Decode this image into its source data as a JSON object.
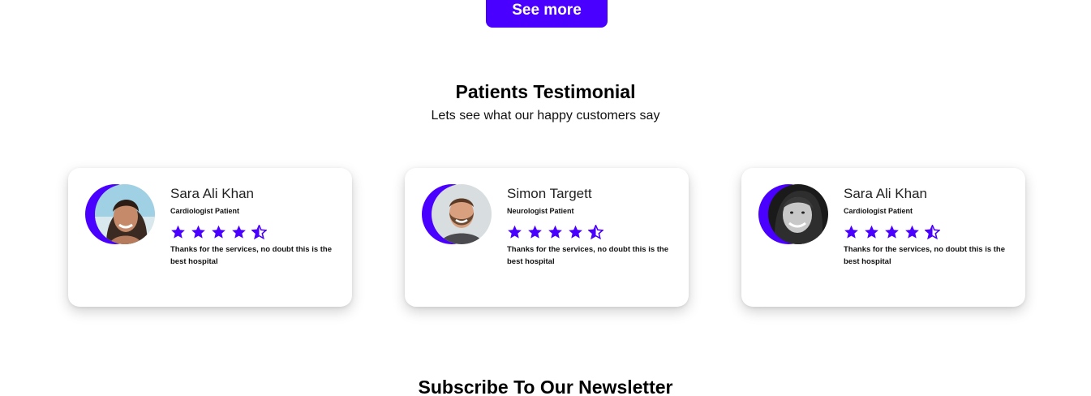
{
  "see_more_label": "See more",
  "testimonials": {
    "title": "Patients Testimonial",
    "subtitle": "Lets see what our happy customers say",
    "cards": [
      {
        "name": "Sara Ali Khan",
        "role": "Cardiologist Patient",
        "rating": 4.5,
        "text": "Thanks for the services, no doubt this is the best hospital"
      },
      {
        "name": "Simon Targett",
        "role": "Neurologist Patient",
        "rating": 4.5,
        "text": "Thanks for the services, no doubt this is the best hospital"
      },
      {
        "name": "Sara Ali Khan",
        "role": "Cardiologist Patient",
        "rating": 4.5,
        "text": "Thanks for the services, no doubt this is the best hospital"
      }
    ]
  },
  "newsletter": {
    "title": "Subscribe To Our Newsletter"
  },
  "colors": {
    "accent": "#4a00ff"
  },
  "icons": {
    "star_full": "star-icon",
    "star_half": "star-half-icon"
  }
}
